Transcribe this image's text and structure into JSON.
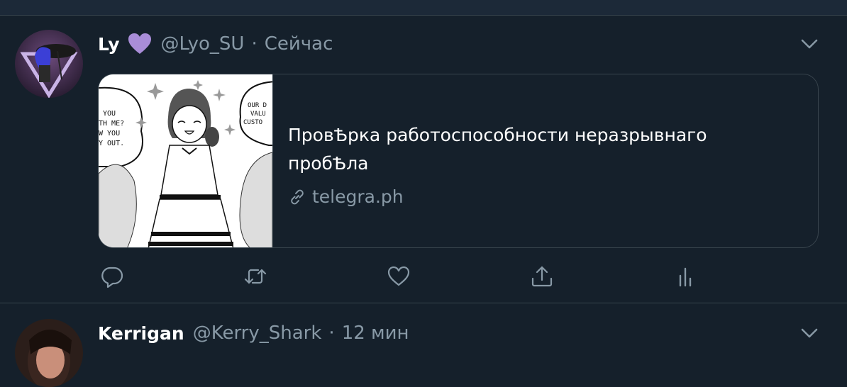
{
  "tweets": [
    {
      "display_name": "Ly",
      "badge_icon": "purple-heart-icon",
      "handle": "@Lyo_SU",
      "separator": "·",
      "time": "Сейчас",
      "card": {
        "title": "ПровѢрка работоспособности неразрывнаго пробѢла",
        "domain": "telegra.ph",
        "thumbnail_texts": [
          "YOU",
          "TH ME?",
          "W YOU",
          "Y OUT.",
          "OUR D",
          "VALU",
          "CUSTO"
        ]
      },
      "actions": [
        "reply-icon",
        "retweet-icon",
        "like-icon",
        "share-icon",
        "analytics-icon"
      ]
    },
    {
      "display_name": "Kerrigan",
      "handle": "@Kerry_Shark",
      "separator": "·",
      "time": "12 мин"
    }
  ],
  "colors": {
    "background": "#15202b",
    "border": "#38444d",
    "secondary_text": "#8899a6",
    "heart": "#a98dd8"
  }
}
